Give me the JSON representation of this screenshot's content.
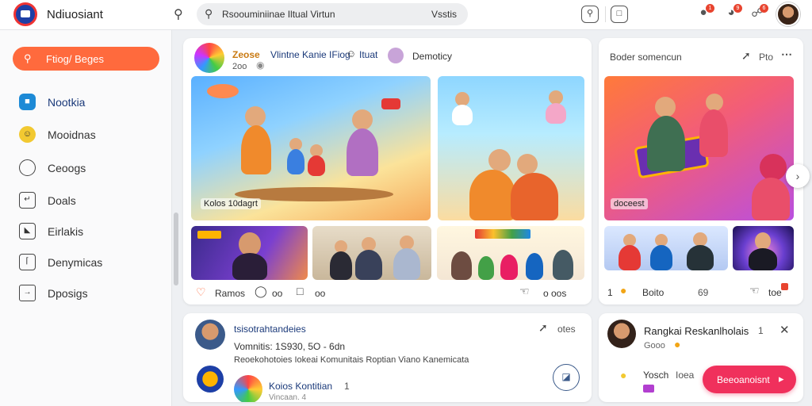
{
  "header": {
    "app_title": "Ndiuosiant",
    "search_value": "Rsoouminiinae Iltual Virtun",
    "search_side_label": "Vsstis",
    "notification_counts": [
      "1",
      "9",
      "6"
    ]
  },
  "sidebar": {
    "primary_button_label": "Ftiog/ Beges",
    "items": [
      {
        "label": "Nootkia",
        "icon": "home-icon"
      },
      {
        "label": "Mooidnas",
        "icon": "emoji-icon"
      },
      {
        "label": "Ceoogs",
        "icon": "chat-icon"
      },
      {
        "label": "Doals",
        "icon": "document-icon"
      },
      {
        "label": "Eirlakis",
        "icon": "image-icon"
      },
      {
        "label": "Denymicas",
        "icon": "frame-icon"
      },
      {
        "label": "Dposigs",
        "icon": "mail-icon"
      }
    ]
  },
  "post_main": {
    "author": "Zeose",
    "title_line": "Vlintne Kanie IFiog",
    "title_tag": "Ituat",
    "meta_left": "2oo",
    "meta_right": "Demoticy",
    "hero_caption": "Kolos 10dagrt",
    "actions": {
      "like_label": "Ramos",
      "comment_label": "oo",
      "share_label": "oo",
      "views_label": "o oos"
    }
  },
  "post_side": {
    "header": "Boder somencun",
    "share_label": "Pto",
    "caption": "doceest",
    "actions": {
      "count_left": "1",
      "like_label": "Boito",
      "count_mid": "69",
      "share_label": "toe"
    }
  },
  "post_bottom": {
    "author": "tsisotrahtandeies",
    "share_label": "otes",
    "stats": "Vomnitis: 1S930, 5O - 6dn",
    "text": "Reoekohotoies Iokeai Komunitais Roptian Viano Kanemicata",
    "comment_author": "Koios Kontitian",
    "comment_count": "1",
    "comment_meta": "Vincaan. 4"
  },
  "suggestion": {
    "title": "Rangkai Reskanlholais",
    "count": "1",
    "meta": "Gooo",
    "item_label": "Yosch",
    "item_value": "Ioea",
    "action_label": "Beeoanoisnt"
  },
  "colors": {
    "accent": "#ff6a3d",
    "cta": "#f0305c",
    "brand": "#1d3fa6"
  }
}
